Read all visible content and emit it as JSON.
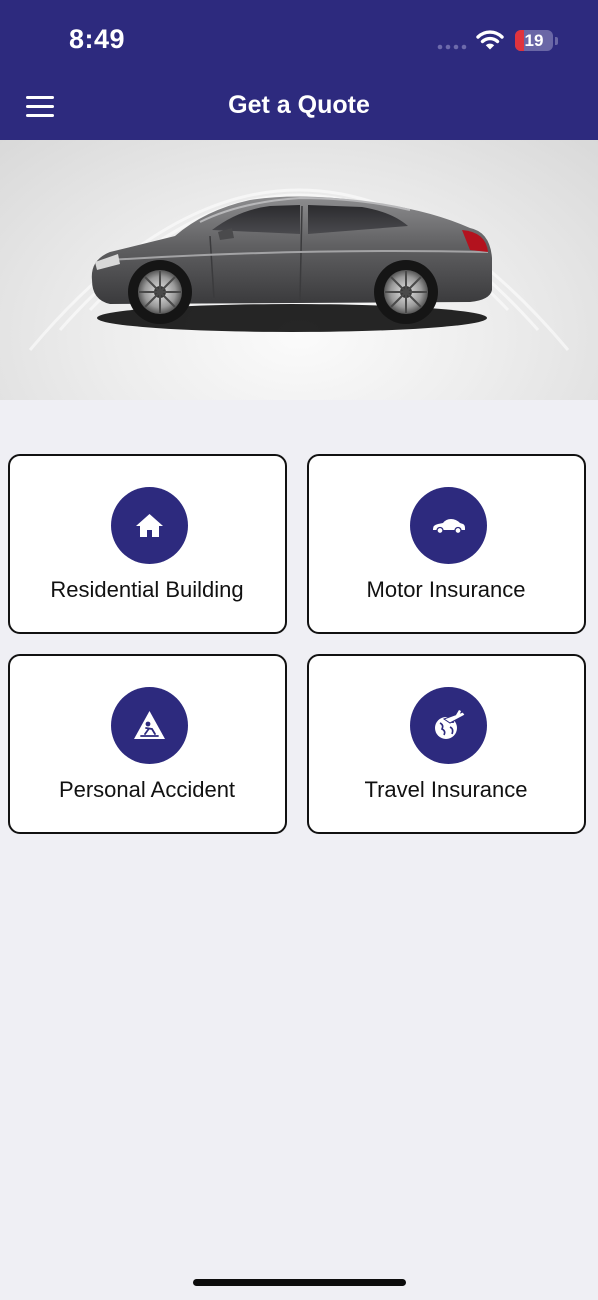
{
  "status_bar": {
    "time": "8:49",
    "battery_level": "19"
  },
  "header": {
    "title": "Get a Quote",
    "menu_icon": "hamburger-menu-icon"
  },
  "banner": {
    "image": "car-side-view"
  },
  "cards": [
    {
      "label": "Residential Building",
      "icon": "house-icon"
    },
    {
      "label": "Motor Insurance",
      "icon": "car-icon"
    },
    {
      "label": "Personal Accident",
      "icon": "accident-warning-icon"
    },
    {
      "label": "Travel Insurance",
      "icon": "globe-plane-icon"
    }
  ],
  "colors": {
    "primary": "#2d2a7e",
    "background": "#efeff4",
    "card_border": "#111111",
    "battery_low": "#e0333d"
  }
}
